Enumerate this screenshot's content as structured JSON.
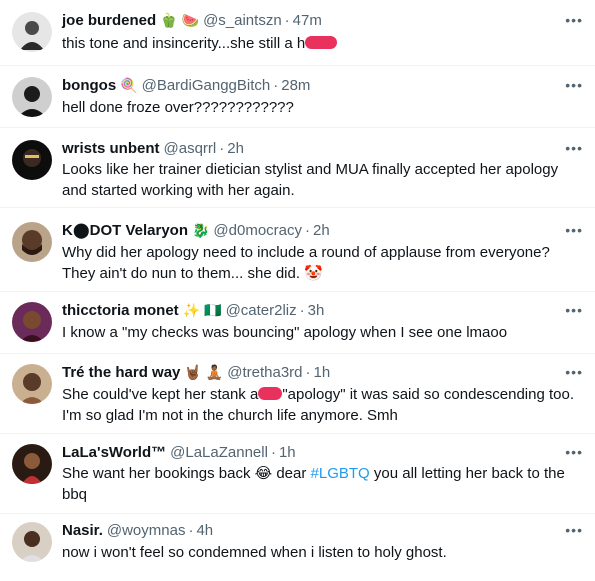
{
  "tweets": [
    {
      "name": "joe burdened",
      "emojis": [
        "🫑",
        "🍉"
      ],
      "handle": "@s_aintszn",
      "time": "47m",
      "text": "this tone and insincerity...she still a h"
    },
    {
      "name": "bongos",
      "emojis": [
        "🍭"
      ],
      "handle": "@BardiGanggBitch",
      "time": "28m",
      "text": "hell done froze over????????????"
    },
    {
      "name": "wrists unbent",
      "emojis": [],
      "handle": "@asqrrl",
      "time": "2h",
      "text": "Looks like her trainer dietician stylist and MUA finally accepted her apology and started working with her again."
    },
    {
      "name": "K⬤DOT Velaryon",
      "emojis": [
        "🐉"
      ],
      "handle": "@d0mocracy",
      "time": "2h",
      "text": "Why did her apology need to include a round of applause from everyone? They ain't do nun to them... she did. 🤡"
    },
    {
      "name": "thicctoria monet",
      "emojis": [
        "✨",
        "🇳🇬"
      ],
      "handle": "@cater2liz",
      "time": "3h",
      "text": "I know a \"my checks was bouncing\" apology when I see one lmaoo"
    },
    {
      "name": "Tré the hard way",
      "emojis": [
        "🤘🏾",
        "🧘🏾"
      ],
      "handle": "@tretha3rd",
      "time": "1h",
      "text_a": "She could've kept her stank a",
      "text_b": "\"apology\" it was said so condescending too. I'm so glad I'm not in the church life anymore. Smh"
    },
    {
      "name": "LaLa'sWorld™",
      "emojis": [],
      "handle": "@LaLaZannell",
      "time": "1h",
      "text_a": "She want her bookings back 😂 dear ",
      "hashtag": "#LGBTQ",
      "text_b": " you all letting her back to the bbq"
    },
    {
      "name": "Nasir.",
      "emojis": [],
      "handle": "@woymnas",
      "time": "4h",
      "text": "now i won't feel so condemned when i listen to holy ghost."
    }
  ],
  "ui": {
    "more_glyph": "•••",
    "separator": "·"
  }
}
